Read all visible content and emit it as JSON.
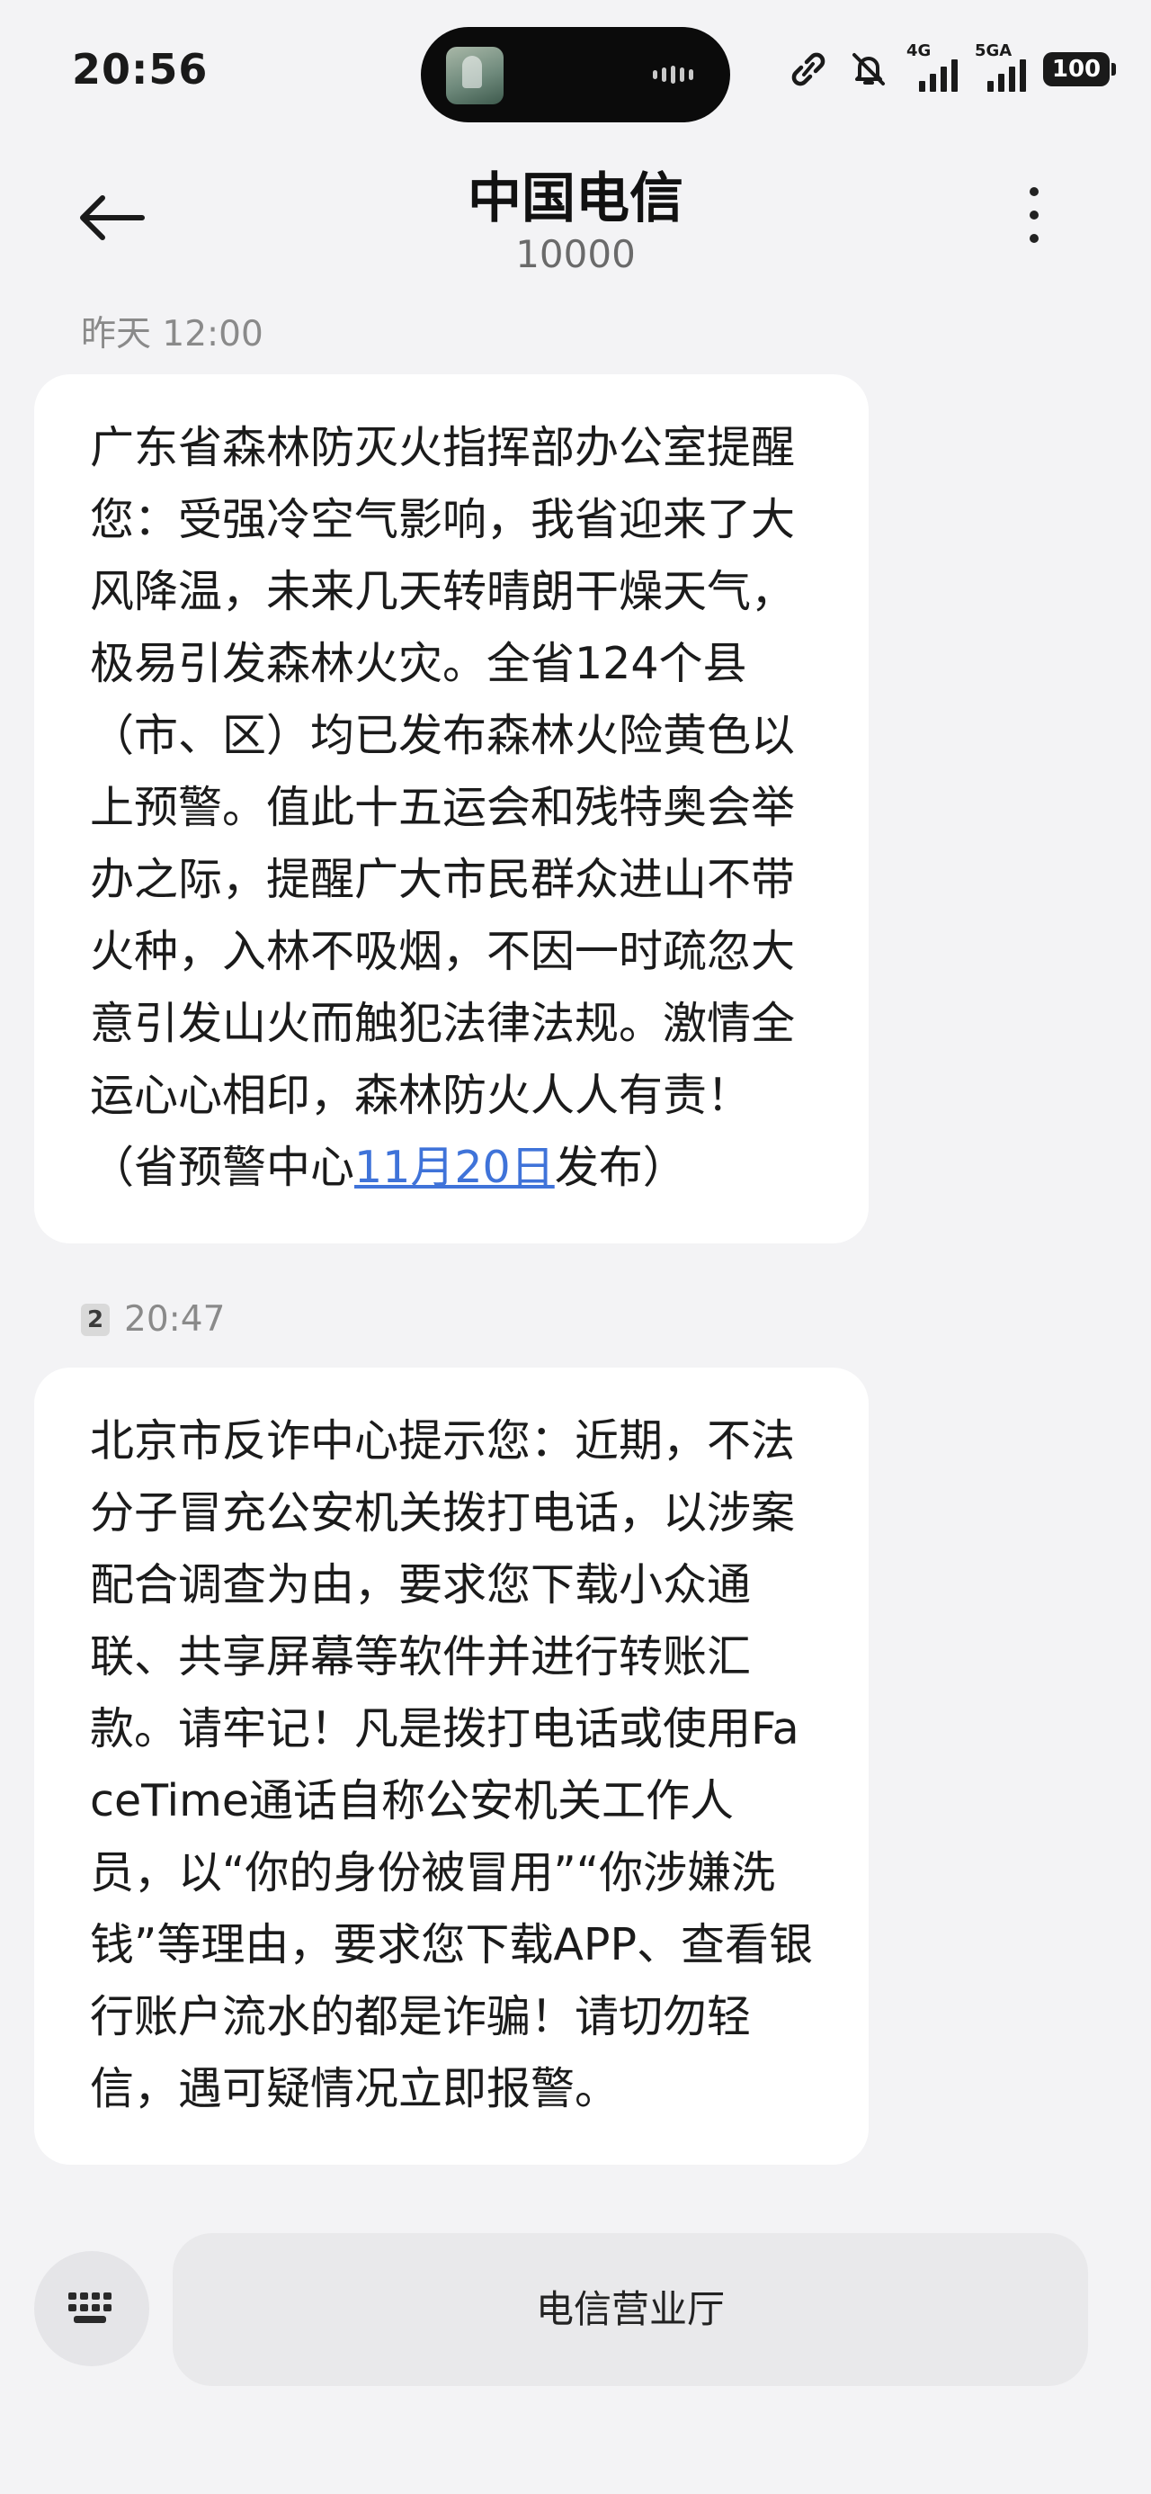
{
  "status_bar": {
    "time": "20:56",
    "network_1": "4G",
    "network_2": "5GA",
    "battery": "100"
  },
  "header": {
    "title": "中国电信",
    "subtitle": "10000"
  },
  "messages": [
    {
      "timestamp": "昨天 12:00",
      "text_before_link": "广东省森林防灭火指挥部办公室提醒您：受强冷空气影响，我省迎来了大风降温，未来几天转晴朗干燥天气，极易引发森林火灾。全省124个县（市、区）均已发布森林火险黄色以上预警。值此十五运会和残特奥会举办之际，提醒广大市民群众进山不带火种，入林不吸烟，不因一时疏忽大意引发山火而触犯法律法规。激情全运心心相印，森林防火人人有责！（省预警中心",
      "link": "11月20日",
      "text_after_link": "发布）"
    },
    {
      "sim": "2",
      "timestamp": "20:47",
      "text": "北京市反诈中心提示您：近期，不法分子冒充公安机关拨打电话，以涉案配合调查为由，要求您下载小众通联、共享屏幕等软件并进行转账汇款。请牢记！凡是拨打电话或使用FaceTime通话自称公安机关工作人员，以“你的身份被冒用”“你涉嫌洗钱”等理由，要求您下载APP、查看银行账户流水的都是诈骗！请切勿轻信，遇可疑情况立即报警。"
    }
  ],
  "bottom_bar": {
    "keyboard_icon": "keyboard-icon",
    "quick_reply": "电信营业厅"
  },
  "colors": {
    "background": "#f3f3f5",
    "bubble": "#ffffff",
    "link": "#3f73d9"
  }
}
